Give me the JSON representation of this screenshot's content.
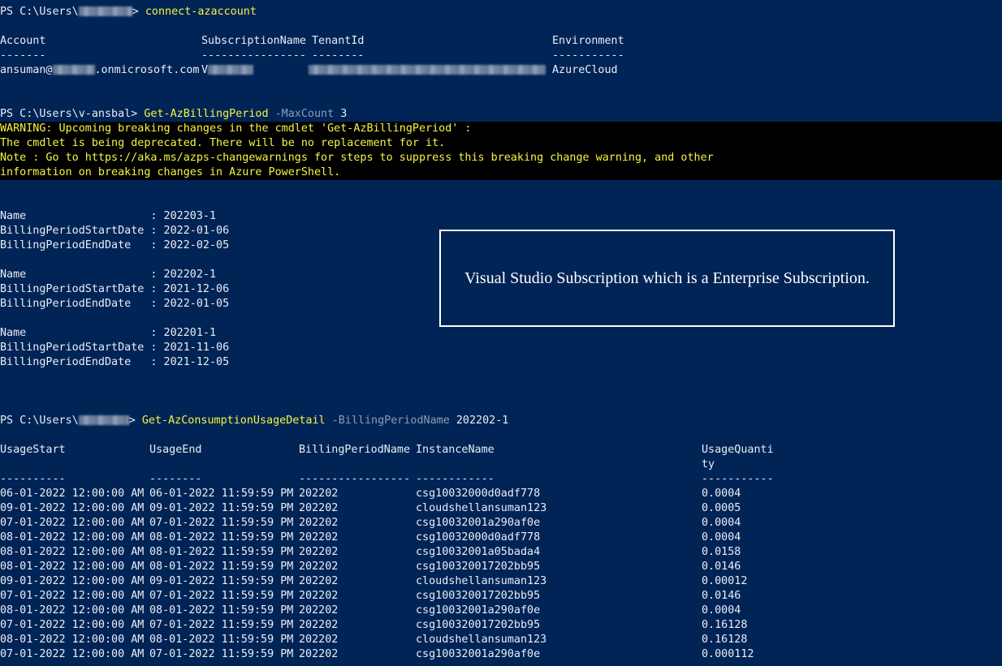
{
  "terminal": {
    "prompt1": {
      "prefix": "PS C:\\Users\\",
      "suffix": "> ",
      "command": "connect-azaccount"
    },
    "account_table": {
      "headers": [
        "Account",
        "SubscriptionName",
        "TenantId",
        "Environment"
      ],
      "underlines": [
        "-------",
        "----------------",
        "--------",
        "-----------"
      ],
      "row": {
        "account_prefix": "ansuman@",
        "account_suffix": ".onmicrosoft.com",
        "subscription_prefix": "V",
        "environment": "AzureCloud"
      }
    },
    "prompt2": {
      "prompt": "PS C:\\Users\\v-ansbal> ",
      "command": "Get-AzBillingPeriod",
      "param": " -MaxCount",
      "value": " 3"
    },
    "warnings": [
      "WARNING: Upcoming breaking changes in the cmdlet 'Get-AzBillingPeriod' :",
      "The cmdlet is being deprecated. There will be no replacement for it.",
      "Note : Go to https://aka.ms/azps-changewarnings for steps to suppress this breaking change warning, and other",
      "information on breaking changes in Azure PowerShell."
    ],
    "billing_periods": [
      [
        "Name                   : 202203-1",
        "BillingPeriodStartDate : 2022-01-06",
        "BillingPeriodEndDate   : 2022-02-05"
      ],
      [
        "Name                   : 202202-1",
        "BillingPeriodStartDate : 2021-12-06",
        "BillingPeriodEndDate   : 2022-01-05"
      ],
      [
        "Name                   : 202201-1",
        "BillingPeriodStartDate : 2021-11-06",
        "BillingPeriodEndDate   : 2021-12-05"
      ]
    ],
    "prompt3": {
      "prefix": "PS C:\\Users\\",
      "suffix": "> ",
      "command": "Get-AzConsumptionUsageDetail",
      "param": " -BillingPeriodName",
      "value": " 202202-1"
    },
    "usage_table": {
      "headers": [
        "UsageStart",
        "UsageEnd",
        "BillingPeriodName",
        "InstanceName",
        "UsageQuanti",
        "ty"
      ],
      "underlines": [
        "----------",
        "--------",
        "-----------------",
        "------------",
        "-----------"
      ],
      "rows": [
        [
          "06-01-2022 12:00:00 AM",
          "06-01-2022 11:59:59 PM",
          "202202",
          "csg10032000d0adf778",
          "0.0004"
        ],
        [
          "09-01-2022 12:00:00 AM",
          "09-01-2022 11:59:59 PM",
          "202202",
          "cloudshellansuman123",
          "0.0005"
        ],
        [
          "07-01-2022 12:00:00 AM",
          "07-01-2022 11:59:59 PM",
          "202202",
          "csg10032001a290af0e",
          "0.0004"
        ],
        [
          "08-01-2022 12:00:00 AM",
          "08-01-2022 11:59:59 PM",
          "202202",
          "csg10032000d0adf778",
          "0.0004"
        ],
        [
          "08-01-2022 12:00:00 AM",
          "08-01-2022 11:59:59 PM",
          "202202",
          "csg10032001a05bada4",
          "0.0158"
        ],
        [
          "08-01-2022 12:00:00 AM",
          "08-01-2022 11:59:59 PM",
          "202202",
          "csg100320017202bb95",
          "0.0146"
        ],
        [
          "09-01-2022 12:00:00 AM",
          "09-01-2022 11:59:59 PM",
          "202202",
          "cloudshellansuman123",
          "0.00012"
        ],
        [
          "07-01-2022 12:00:00 AM",
          "07-01-2022 11:59:59 PM",
          "202202",
          "csg100320017202bb95",
          "0.0146"
        ],
        [
          "08-01-2022 12:00:00 AM",
          "08-01-2022 11:59:59 PM",
          "202202",
          "csg10032001a290af0e",
          "0.0004"
        ],
        [
          "07-01-2022 12:00:00 AM",
          "07-01-2022 11:59:59 PM",
          "202202",
          "csg100320017202bb95",
          "0.16128"
        ],
        [
          "08-01-2022 12:00:00 AM",
          "08-01-2022 11:59:59 PM",
          "202202",
          "cloudshellansuman123",
          "0.16128"
        ],
        [
          "07-01-2022 12:00:00 AM",
          "07-01-2022 11:59:59 PM",
          "202202",
          "csg10032001a290af0e",
          "0.000112"
        ]
      ]
    }
  },
  "callout": {
    "text": "Visual Studio Subscription which is a Enterprise Subscription."
  },
  "colors": {
    "background": "#012456",
    "command": "#f5f542",
    "parameter": "#8e9bb0",
    "text": "#e9eef5",
    "warning_bg": "#000000"
  }
}
